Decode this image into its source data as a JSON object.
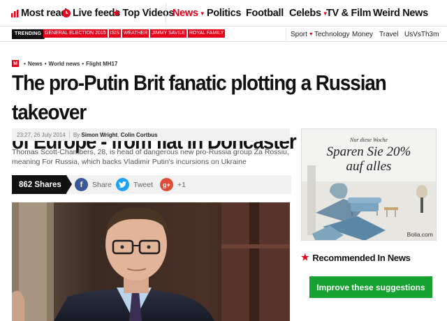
{
  "topnav": {
    "most_read": "Most read",
    "live_feeds": "Live feeds",
    "top_videos": "Top Videos",
    "news": "News",
    "politics": "Politics",
    "football": "Football",
    "celebs": "Celebs",
    "tv_film": "TV & Film",
    "weird_news": "Weird News"
  },
  "trending": {
    "label": "TRENDING",
    "tags": [
      "GENERAL ELECTION 2015",
      "ISIS",
      "WEATHER",
      "JIMMY SAVILE",
      "ROYAL FAMILY"
    ]
  },
  "subnav": {
    "sport": "Sport",
    "technology": "Technology",
    "money": "Money",
    "travel": "Travel",
    "usvsth3m": "UsVsTh3m"
  },
  "breadcrumb": {
    "logo": "M",
    "items": [
      "News",
      "World news",
      "Flight MH17"
    ]
  },
  "article": {
    "headline_line1": "The pro-Putin Brit fanatic plotting a Russian takeover",
    "headline_line2": "of Europe - from flat in Doncaster",
    "timestamp": "23:27, 26 July 2014",
    "by": "By",
    "author1": "Simon Wright",
    "author2": "Colin Cortbus",
    "standfirst": "Thomas Scott-Chambers, 28, is head of dangerous new pro-Russia group Za Rossiu, meaning For Russia, which backs Vladimir Putin's incursions on Ukraine"
  },
  "share": {
    "count": "862 Shares",
    "facebook": "Share",
    "twitter": "Tweet",
    "gplus": "+1"
  },
  "ad": {
    "line1": "Nur diese Woche",
    "line2": "Sparen Sie 20%",
    "line3": "auf alles",
    "brand": "Bolia.com"
  },
  "sidebar": {
    "recommended_title": "Recommended In News",
    "improve_button": "Improve these suggestions"
  },
  "colors": {
    "brand_red": "#e4001b",
    "button_green": "#16a230",
    "facebook_blue": "#3b5998",
    "twitter_blue": "#1da1f2",
    "gplus_red": "#dd4b39"
  }
}
